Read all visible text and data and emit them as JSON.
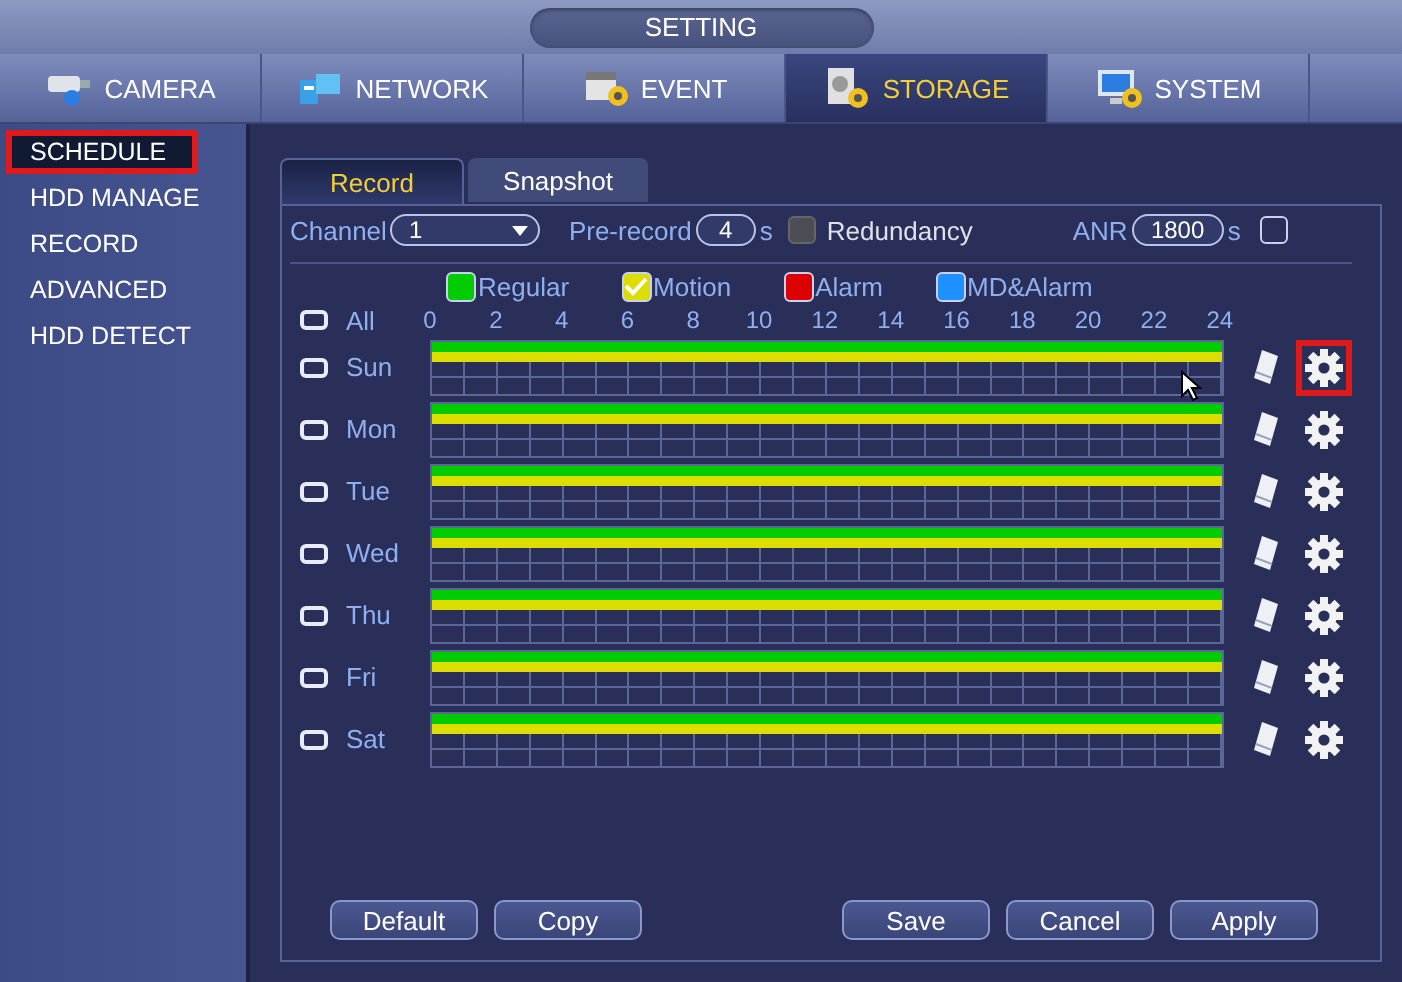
{
  "window": {
    "title": "SETTING"
  },
  "tabs": [
    {
      "label": "CAMERA",
      "kind": "camera",
      "selected": false
    },
    {
      "label": "NETWORK",
      "kind": "network",
      "selected": false
    },
    {
      "label": "EVENT",
      "kind": "event",
      "selected": false
    },
    {
      "label": "STORAGE",
      "kind": "storage",
      "selected": true
    },
    {
      "label": "SYSTEM",
      "kind": "system",
      "selected": false
    }
  ],
  "sidebar": {
    "items": [
      {
        "label": "SCHEDULE",
        "selected": true,
        "highlighted": true
      },
      {
        "label": "HDD MANAGE",
        "selected": false,
        "highlighted": false
      },
      {
        "label": "RECORD",
        "selected": false,
        "highlighted": false
      },
      {
        "label": "ADVANCED",
        "selected": false,
        "highlighted": false
      },
      {
        "label": "HDD DETECT",
        "selected": false,
        "highlighted": false
      }
    ]
  },
  "subtabs": [
    {
      "label": "Record",
      "selected": true
    },
    {
      "label": "Snapshot",
      "selected": false
    }
  ],
  "controls": {
    "channel_label": "Channel",
    "channel": "1",
    "prerecord_label": "Pre-record",
    "prerecord": "4",
    "prerecord_unit": "s",
    "redundancy_label": "Redundancy",
    "redundancy": false,
    "anr_label": "ANR",
    "anr": "1800",
    "anr_unit": "s",
    "anr_checked": false
  },
  "legend": [
    {
      "label": "Regular",
      "color": "#00cc00",
      "checked": false
    },
    {
      "label": "Motion",
      "color": "#dddd00",
      "checked": true
    },
    {
      "label": "Alarm",
      "color": "#dd0000",
      "checked": false
    },
    {
      "label": "MD&Alarm",
      "color": "#1e90ff",
      "checked": false
    }
  ],
  "all": {
    "label": "All",
    "checked": false
  },
  "hours": [
    "0",
    "2",
    "4",
    "6",
    "8",
    "10",
    "12",
    "14",
    "16",
    "18",
    "20",
    "22",
    "24"
  ],
  "days": [
    {
      "label": "Sun",
      "checked": false,
      "gear_highlighted": true,
      "tracks": [
        {
          "color": "#00cc00",
          "level": 1
        },
        {
          "color": "#dddd00",
          "level": 1
        }
      ]
    },
    {
      "label": "Mon",
      "checked": false,
      "gear_highlighted": false,
      "tracks": [
        {
          "color": "#00cc00",
          "level": 1
        },
        {
          "color": "#dddd00",
          "level": 1
        }
      ]
    },
    {
      "label": "Tue",
      "checked": false,
      "gear_highlighted": false,
      "tracks": [
        {
          "color": "#00cc00",
          "level": 1
        },
        {
          "color": "#dddd00",
          "level": 1
        }
      ]
    },
    {
      "label": "Wed",
      "checked": false,
      "gear_highlighted": false,
      "tracks": [
        {
          "color": "#00cc00",
          "level": 1
        },
        {
          "color": "#dddd00",
          "level": 1
        }
      ]
    },
    {
      "label": "Thu",
      "checked": false,
      "gear_highlighted": false,
      "tracks": [
        {
          "color": "#00cc00",
          "level": 1
        },
        {
          "color": "#dddd00",
          "level": 1
        }
      ]
    },
    {
      "label": "Fri",
      "checked": false,
      "gear_highlighted": false,
      "tracks": [
        {
          "color": "#00cc00",
          "level": 1
        },
        {
          "color": "#dddd00",
          "level": 1
        }
      ]
    },
    {
      "label": "Sat",
      "checked": false,
      "gear_highlighted": false,
      "tracks": [
        {
          "color": "#00cc00",
          "level": 1
        },
        {
          "color": "#dddd00",
          "level": 1
        }
      ]
    }
  ],
  "buttons_left": [
    "Default",
    "Copy"
  ],
  "buttons_right": [
    "Save",
    "Cancel",
    "Apply"
  ]
}
